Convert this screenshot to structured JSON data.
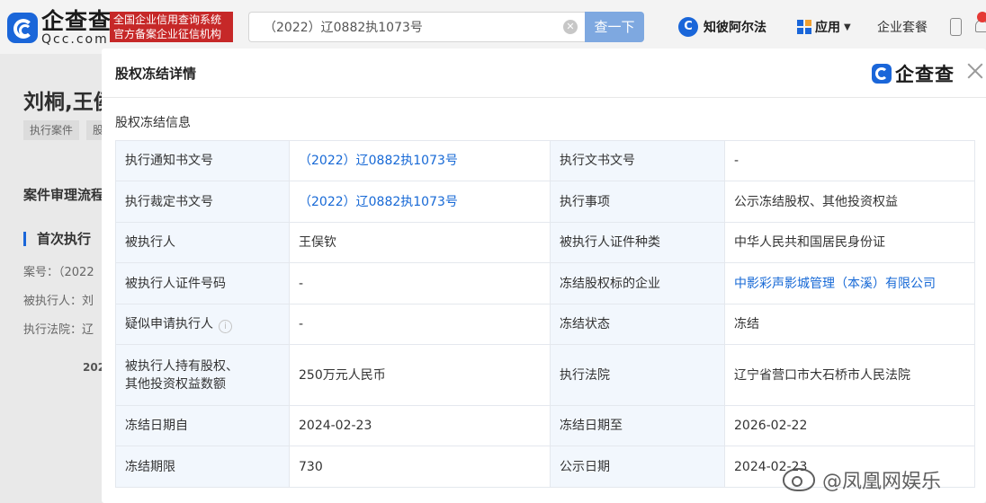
{
  "header": {
    "logo_cn": "企查查",
    "logo_en": "Qcc.com",
    "badge_line1": "全国企业信用查询系统",
    "badge_line2": "官方备案企业征信机构",
    "search_value": "（2022）辽0882执1073号",
    "search_button": "查一下",
    "nav_zhibi": "知彼阿尔法",
    "nav_zhibi_icon_letter": "C",
    "nav_apps": "应用",
    "nav_suite": "企业套餐"
  },
  "background": {
    "title": "刘桐,王侯",
    "tags": [
      "执行案件",
      "股"
    ],
    "section": "案件审理流程",
    "first": "首次执行",
    "case_no": "案号：（2022",
    "executed": "被执行人：刘",
    "court": "执行法院：辽",
    "year": "202"
  },
  "modal": {
    "title": "股权冻结详情",
    "logo_text": "企查查",
    "section_title": "股权冻结信息",
    "rows": [
      {
        "k1": "执行通知书文号",
        "v1": "（2022）辽0882执1073号",
        "k2": "执行文书文号",
        "v2": "-"
      },
      {
        "k1": "执行裁定书文号",
        "v1": "（2022）辽0882执1073号",
        "k2": "执行事项",
        "v2": "公示冻结股权、其他投资权益"
      },
      {
        "k1": "被执行人",
        "v1": "王俣钦",
        "k2": "被执行人证件种类",
        "v2": "中华人民共和国居民身份证"
      },
      {
        "k1": "被执行人证件号码",
        "v1": "-",
        "k2": "冻结股权标的企业",
        "v2": "中影彩声影城管理（本溪）有限公司"
      },
      {
        "k1": "疑似申请执行人",
        "v1": "-",
        "k2": "冻结状态",
        "v2": "冻结"
      },
      {
        "k1a": "被执行人持有股权、",
        "k1b": "其他投资权益数额",
        "v1": "250万元人民币",
        "k2": "执行法院",
        "v2": "辽宁省营口市大石桥市人民法院"
      },
      {
        "k1": "冻结日期自",
        "v1": "2024-02-23",
        "k2": "冻结日期至",
        "v2": "2026-02-22"
      },
      {
        "k1": "冻结期限",
        "v1": "730",
        "k2": "公示日期",
        "v2": "2024-02-23"
      }
    ]
  },
  "watermark": "@凤凰网娱乐",
  "colors": {
    "brand_blue": "#1a66d9",
    "link_blue": "#1769d6",
    "badge_red": "#c62828",
    "key_cell_bg": "#f2f7fd"
  }
}
